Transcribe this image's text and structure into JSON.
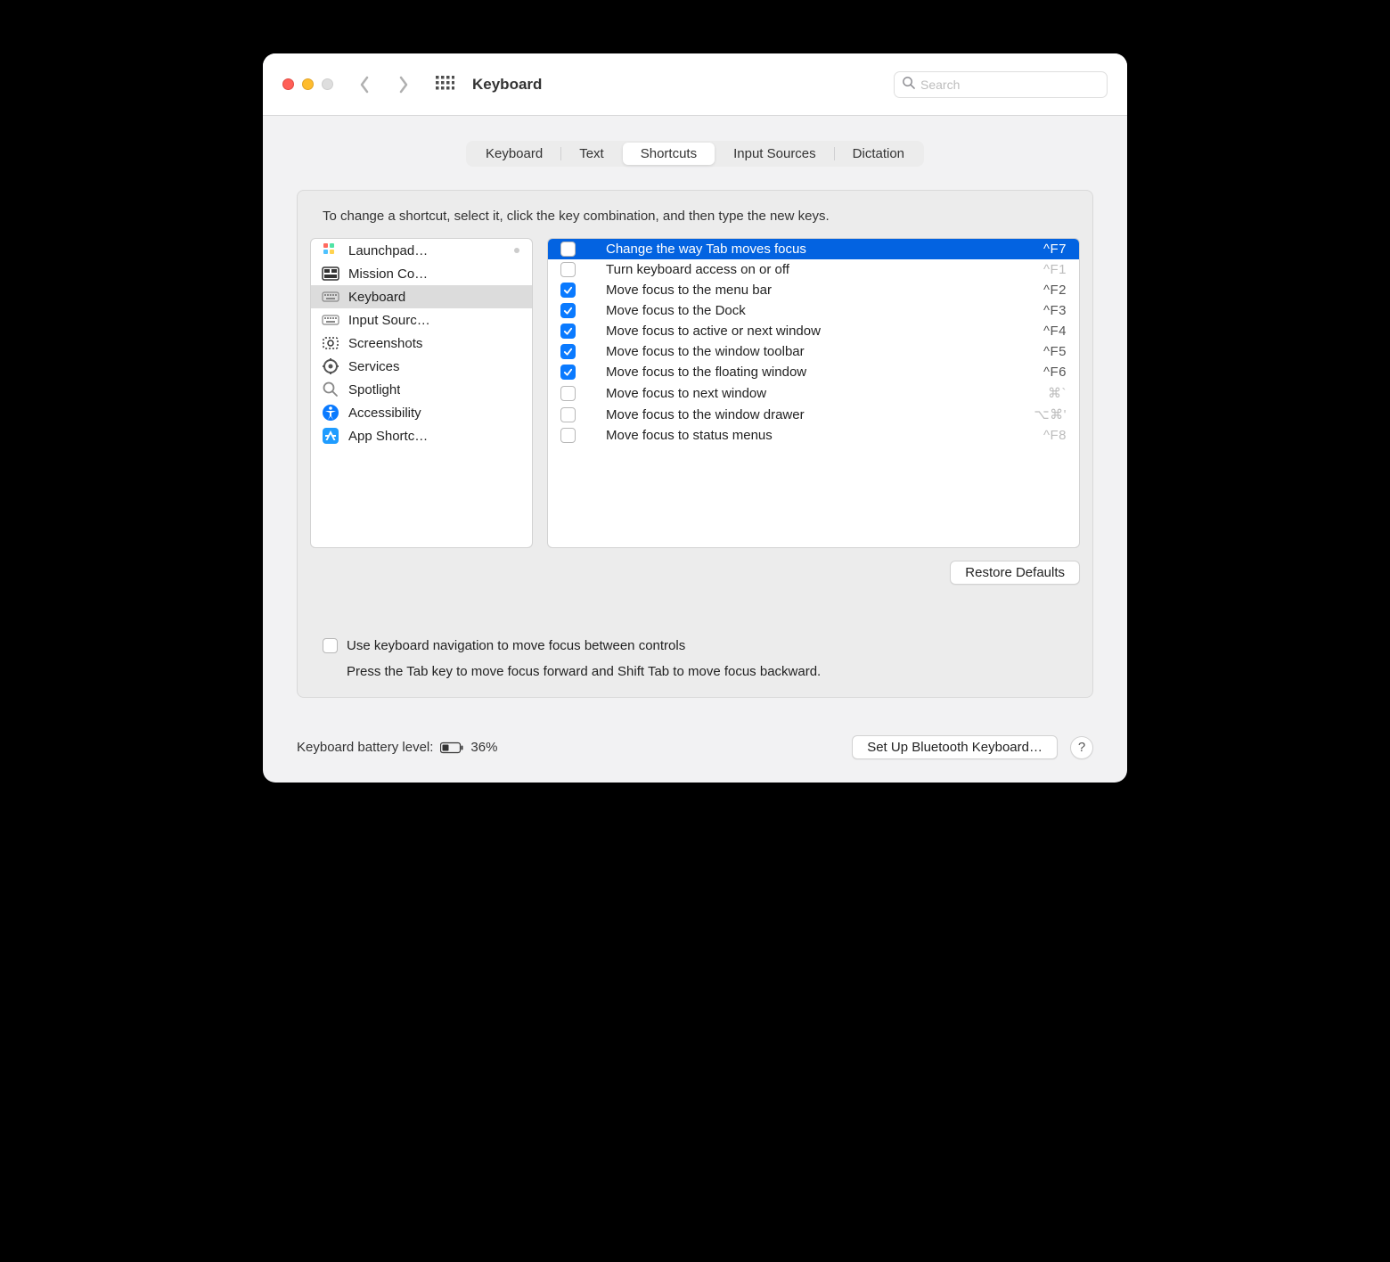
{
  "window": {
    "title": "Keyboard"
  },
  "search": {
    "placeholder": "Search"
  },
  "tabs": [
    "Keyboard",
    "Text",
    "Shortcuts",
    "Input Sources",
    "Dictation"
  ],
  "active_tab": 2,
  "hint": "To change a shortcut, select it, click the key combination, and then type the new keys.",
  "sidebar": {
    "items": [
      {
        "label": "Launchpad…",
        "icon": "launchpad"
      },
      {
        "label": "Mission Co…",
        "icon": "mission"
      },
      {
        "label": "Keyboard",
        "icon": "keyboard"
      },
      {
        "label": "Input Sourc…",
        "icon": "input"
      },
      {
        "label": "Screenshots",
        "icon": "screenshot"
      },
      {
        "label": "Services",
        "icon": "services"
      },
      {
        "label": "Spotlight",
        "icon": "spotlight"
      },
      {
        "label": "Accessibility",
        "icon": "accessibility"
      },
      {
        "label": "App Shortc…",
        "icon": "appstore"
      }
    ],
    "selected": 2
  },
  "shortcuts": [
    {
      "checked": false,
      "label": "Change the way Tab moves focus",
      "key": "^F7",
      "selected": true,
      "enabled": true
    },
    {
      "checked": false,
      "label": "Turn keyboard access on or off",
      "key": "^F1",
      "enabled": false
    },
    {
      "checked": true,
      "label": "Move focus to the menu bar",
      "key": "^F2",
      "enabled": true
    },
    {
      "checked": true,
      "label": "Move focus to the Dock",
      "key": "^F3",
      "enabled": true
    },
    {
      "checked": true,
      "label": "Move focus to active or next window",
      "key": "^F4",
      "enabled": true
    },
    {
      "checked": true,
      "label": "Move focus to the window toolbar",
      "key": "^F5",
      "enabled": true
    },
    {
      "checked": true,
      "label": "Move focus to the floating window",
      "key": "^F6",
      "enabled": true
    },
    {
      "checked": false,
      "label": "Move focus to next window",
      "key": "⌘`",
      "enabled": false
    },
    {
      "checked": false,
      "label": "Move focus to the window drawer",
      "key": "⌥⌘'",
      "enabled": false
    },
    {
      "checked": false,
      "label": "Move focus to status menus",
      "key": "^F8",
      "enabled": false
    }
  ],
  "restore_label": "Restore Defaults",
  "nav_option": {
    "checked": false,
    "label": "Use keyboard navigation to move focus between controls",
    "desc": "Press the Tab key to move focus forward and Shift Tab to move focus backward."
  },
  "footer": {
    "battery_label": "Keyboard battery level:",
    "battery_pct": "36%",
    "bluetooth_btn": "Set Up Bluetooth Keyboard…",
    "help": "?"
  }
}
